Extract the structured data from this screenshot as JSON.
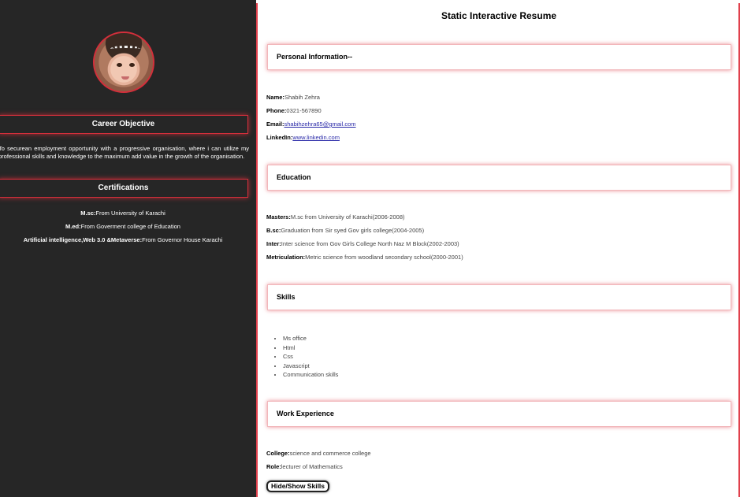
{
  "sidebar": {
    "career_heading": "Career Objective",
    "objective": "To securean employment opportunity with a progressive organisation, where i can utilize my professional skills and knowledge to the maximum add value in the growth of the organisation.",
    "cert_heading": "Certifications",
    "certifications": [
      {
        "label": "M.sc:",
        "value": "From University of Karachi"
      },
      {
        "label": "M.ed:",
        "value": "From Goverment college of Education"
      },
      {
        "label": "Artificial intelligence,Web 3.0 &Metaverse:",
        "value": "From Governor House Karachi"
      }
    ]
  },
  "main": {
    "title": "Static Interactive Resume",
    "personal": {
      "heading": "Personal Information--",
      "name_label": "Name:",
      "name_value": "Shabih Zehra",
      "phone_label": "Phone:",
      "phone_value": "0321-567890",
      "email_label": "Email:",
      "email_value": "shabihzehra65@gmail.com",
      "linkedin_label": "LinkedIn:",
      "linkedin_value": "www.linkedin.com"
    },
    "education": {
      "heading": "Education",
      "items": [
        {
          "label": "Masters:",
          "value": "M.sc from University of Karachi(2006-2008)"
        },
        {
          "label": "B.sc:",
          "value": "Graduation from Sir syed Gov girls college(2004-2005)"
        },
        {
          "label": "Inter:",
          "value": "Inter science from Gov Girls College North Naz M Block(2002-2003)"
        },
        {
          "label": "Metriculation:",
          "value": "Metric science from woodland secondary school(2000-2001)"
        }
      ]
    },
    "skills": {
      "heading": "Skills",
      "items": [
        "Ms office",
        "Html",
        "Css",
        "Javascript",
        "Communication skills"
      ]
    },
    "work": {
      "heading": "Work Experience",
      "college_label": "College:",
      "college_value": "science and commerce college",
      "role_label": "Role:",
      "role_value": "lecturer of Mathematics"
    },
    "toggle_label": "Hide/Show Skills"
  },
  "colors": {
    "sidebar_bg": "#262626",
    "accent": "#d32f3b"
  }
}
